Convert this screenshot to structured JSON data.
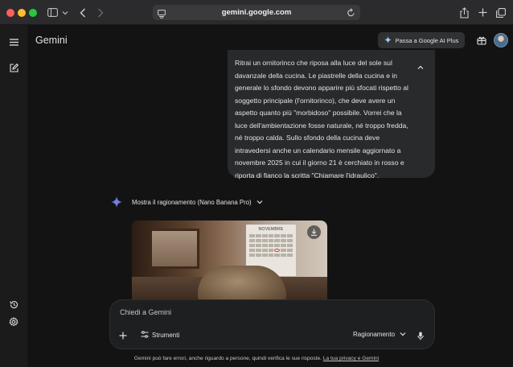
{
  "browser": {
    "url": "gemini.google.com",
    "icons": [
      "sidebar-toggle-icon",
      "chevron-down-icon",
      "back-icon",
      "forward-icon",
      "site-settings-icon",
      "reload-icon",
      "share-icon",
      "new-tab-icon",
      "tabs-overview-icon"
    ]
  },
  "header": {
    "title": "Gemini",
    "upgrade_label": "Passa a Google AI Plus"
  },
  "conversation": {
    "user_prompt": "Ritrai un ornitorinco che riposa alla luce del sole sul davanzale della cucina. Le piastrelle della cucina e in generale lo sfondo devono apparire più sfocati rispetto al soggetto principale (l'ornitorinco), che deve avere un aspetto quanto più \"morbidoso\" possibile. Vorrei che la luce dell'ambientazione fosse naturale, né troppo fredda, né troppo calda. Sullo sfondo della cucina deve intravedersi anche un calendario mensile aggiornato a novembre 2025 in cui il giorno 21 è cerchiato in rosso e riporta di fianco la scritta \"Chiamare l'idraulico\".",
    "reasoning_label": "Mostra il ragionamento (Nano Banana Pro)",
    "image_calendar_title": "NOVEMBRE"
  },
  "composer": {
    "placeholder": "Chiedi a Gemini",
    "tools_label": "Strumenti",
    "mode_label": "Ragionamento"
  },
  "footer": {
    "disclaimer": "Gemini può fare errori, anche riguardo a persone, quindi verifica le sue risposte.",
    "privacy_link": "La tua privacy e Gemini"
  },
  "colors": {
    "background": "#131314",
    "bubble": "#282a2c",
    "accent_spark": "#4c8df6"
  }
}
